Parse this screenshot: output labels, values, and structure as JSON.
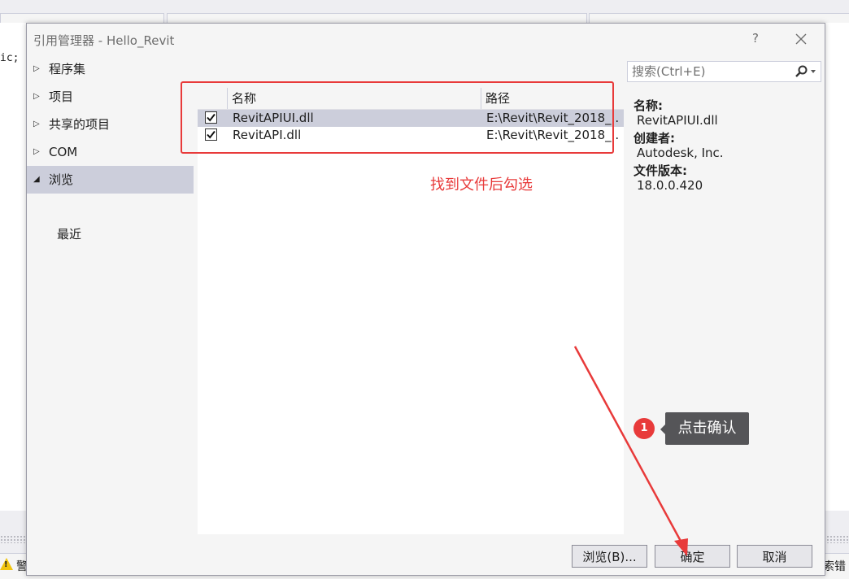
{
  "ide": {
    "code_snippet": "ic;",
    "warning_text": "警",
    "error_search_text": "索错"
  },
  "dialog": {
    "title": "引用管理器 - Hello_Revit",
    "help_label": "?",
    "close_icon": "close-icon"
  },
  "nav": {
    "items": [
      {
        "label": "程序集",
        "expanded": false
      },
      {
        "label": "项目",
        "expanded": false
      },
      {
        "label": "共享的项目",
        "expanded": false
      },
      {
        "label": "COM",
        "expanded": false
      },
      {
        "label": "浏览",
        "expanded": true
      }
    ],
    "sub_items": [
      {
        "label": "最近"
      }
    ]
  },
  "list": {
    "columns": [
      "名称",
      "路径"
    ],
    "rows": [
      {
        "name": "RevitAPIUI.dll",
        "path": "E:\\Revit\\Revit_2018_...",
        "checked": true,
        "selected": true
      },
      {
        "name": "RevitAPI.dll",
        "path": "E:\\Revit\\Revit_2018_...",
        "checked": true,
        "selected": false
      }
    ]
  },
  "annotations": {
    "red_note": "找到文件后勾选",
    "step_number": "1",
    "step_tooltip": "点击确认",
    "color": "#e83a3a"
  },
  "search": {
    "placeholder": "搜索(Ctrl+E)",
    "icon": "search-icon"
  },
  "details": {
    "name_label": "名称:",
    "name_value": "RevitAPIUI.dll",
    "creator_label": "创建者:",
    "creator_value": "Autodesk, Inc.",
    "version_label": "文件版本:",
    "version_value": "18.0.0.420"
  },
  "buttons": {
    "browse": "浏览(B)...",
    "ok": "确定",
    "cancel": "取消"
  }
}
